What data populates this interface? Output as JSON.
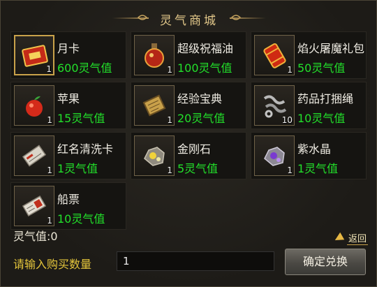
{
  "window": {
    "title": "灵气商城"
  },
  "items": [
    {
      "name": "月卡",
      "price": "600灵气值",
      "qty": "1",
      "icon": "monthly-card-icon"
    },
    {
      "name": "超级祝福油",
      "price": "100灵气值",
      "qty": "1",
      "icon": "blessing-oil-icon"
    },
    {
      "name": "焰火屠魔礼包",
      "price": "50灵气值",
      "qty": "1",
      "icon": "firework-gift-pack-icon"
    },
    {
      "name": "苹果",
      "price": "15灵气值",
      "qty": "1",
      "icon": "apple-icon"
    },
    {
      "name": "经验宝典",
      "price": "20灵气值",
      "qty": "1",
      "icon": "exp-book-icon"
    },
    {
      "name": "药品打捆绳",
      "price": "10灵气值",
      "qty": "10",
      "icon": "bundle-rope-icon"
    },
    {
      "name": "红名清洗卡",
      "price": "1灵气值",
      "qty": "1",
      "icon": "red-name-wash-card-icon"
    },
    {
      "name": "金刚石",
      "price": "5灵气值",
      "qty": "1",
      "icon": "diamond-ore-icon"
    },
    {
      "name": "紫水晶",
      "price": "1灵气值",
      "qty": "1",
      "icon": "amethyst-icon"
    },
    {
      "name": "船票",
      "price": "10灵气值",
      "qty": "1",
      "icon": "ship-ticket-icon"
    }
  ],
  "back_label": "返回",
  "balance_label": "灵气值:0",
  "prompt_label": "请输入购买数量",
  "quantity_input_value": "1",
  "confirm_label": "确定兑换",
  "colors": {
    "price": "#22e02a",
    "prompt": "#e4c53b",
    "title": "#e3c88a"
  }
}
